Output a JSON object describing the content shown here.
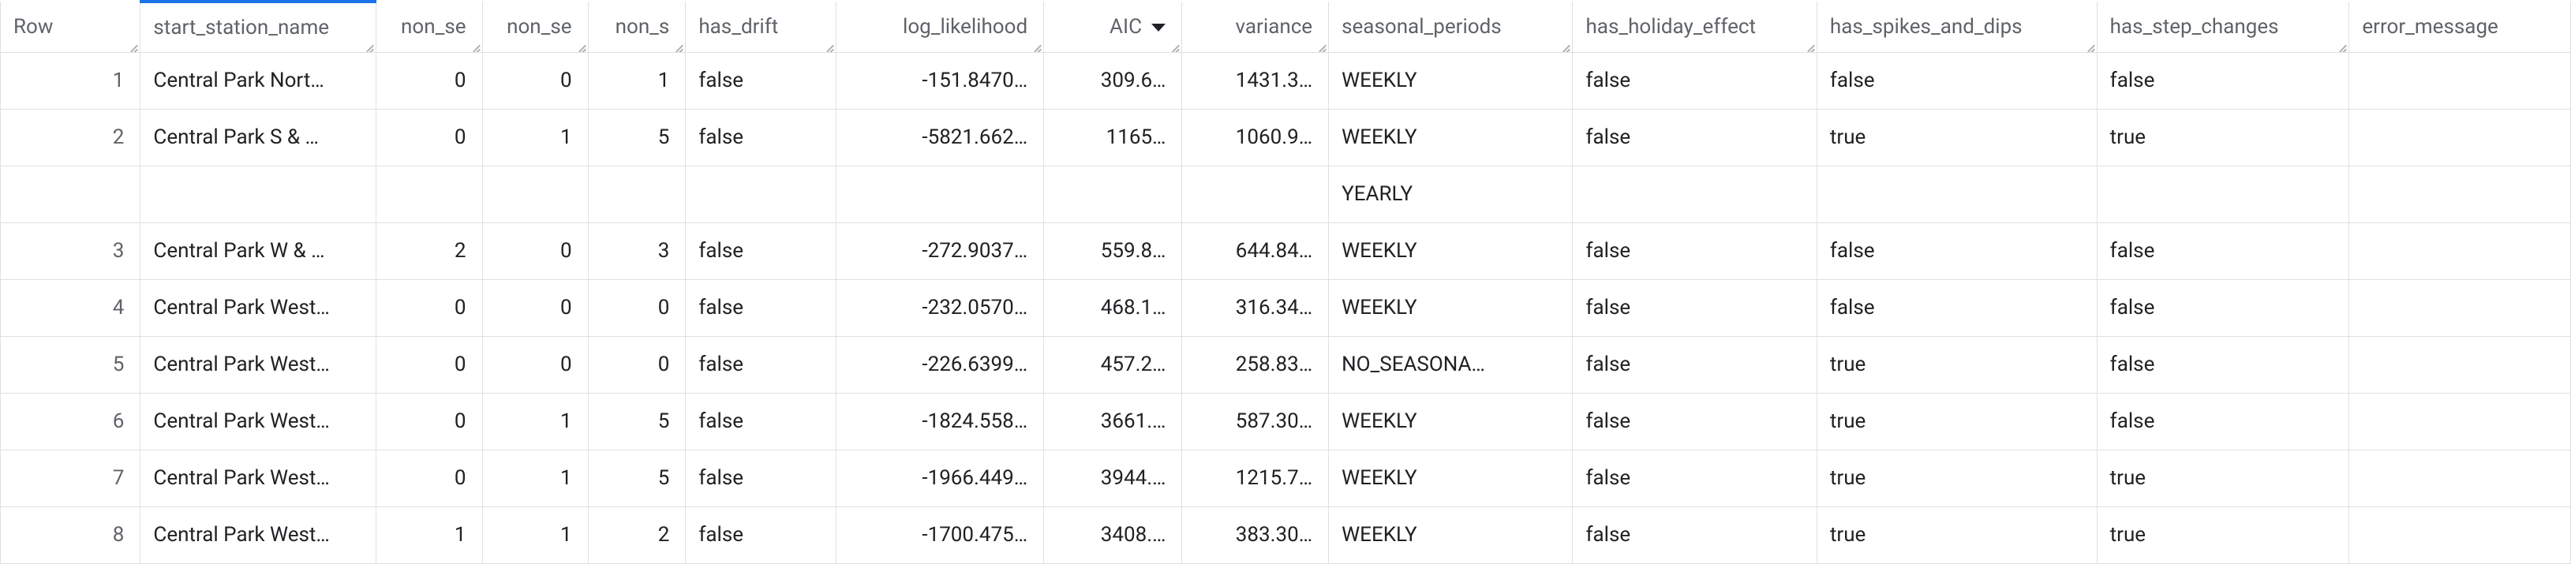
{
  "headers": {
    "row": "Row",
    "start_station_name": "start_station_name",
    "non_se1": "non_se",
    "non_se2": "non_se",
    "non_s": "non_s",
    "has_drift": "has_drift",
    "log_likelihood": "log_likelihood",
    "aic": "AIC",
    "variance": "variance",
    "seasonal_periods": "seasonal_periods",
    "has_holiday_effect": "has_holiday_effect",
    "has_spikes_and_dips": "has_spikes_and_dips",
    "has_step_changes": "has_step_changes",
    "error_message": "error_message"
  },
  "rows": [
    {
      "row": "1",
      "station": "Central Park Nort…",
      "non_se1": "0",
      "non_se2": "0",
      "non_s": "1",
      "drift": "false",
      "loglik": "-151.8470…",
      "aic": "309.6…",
      "variance": "1431.3…",
      "seasonal": "WEEKLY",
      "holiday": "false",
      "spikes": "false",
      "step": "false",
      "error": ""
    },
    {
      "row": "2",
      "station": "Central Park S & …",
      "non_se1": "0",
      "non_se2": "1",
      "non_s": "5",
      "drift": "false",
      "loglik": "-5821.662…",
      "aic": "1165…",
      "variance": "1060.9…",
      "seasonal": "WEEKLY",
      "holiday": "false",
      "spikes": "true",
      "step": "true",
      "error": "",
      "sub_seasonal": "YEARLY"
    },
    {
      "row": "3",
      "station": "Central Park W & …",
      "non_se1": "2",
      "non_se2": "0",
      "non_s": "3",
      "drift": "false",
      "loglik": "-272.9037…",
      "aic": "559.8…",
      "variance": "644.84…",
      "seasonal": "WEEKLY",
      "holiday": "false",
      "spikes": "false",
      "step": "false",
      "error": ""
    },
    {
      "row": "4",
      "station": "Central Park West…",
      "non_se1": "0",
      "non_se2": "0",
      "non_s": "0",
      "drift": "false",
      "loglik": "-232.0570…",
      "aic": "468.1…",
      "variance": "316.34…",
      "seasonal": "WEEKLY",
      "holiday": "false",
      "spikes": "false",
      "step": "false",
      "error": ""
    },
    {
      "row": "5",
      "station": "Central Park West…",
      "non_se1": "0",
      "non_se2": "0",
      "non_s": "0",
      "drift": "false",
      "loglik": "-226.6399…",
      "aic": "457.2…",
      "variance": "258.83…",
      "seasonal": "NO_SEASONA…",
      "holiday": "false",
      "spikes": "true",
      "step": "false",
      "error": ""
    },
    {
      "row": "6",
      "station": "Central Park West…",
      "non_se1": "0",
      "non_se2": "1",
      "non_s": "5",
      "drift": "false",
      "loglik": "-1824.558…",
      "aic": "3661.…",
      "variance": "587.30…",
      "seasonal": "WEEKLY",
      "holiday": "false",
      "spikes": "true",
      "step": "false",
      "error": ""
    },
    {
      "row": "7",
      "station": "Central Park West…",
      "non_se1": "0",
      "non_se2": "1",
      "non_s": "5",
      "drift": "false",
      "loglik": "-1966.449…",
      "aic": "3944.…",
      "variance": "1215.7…",
      "seasonal": "WEEKLY",
      "holiday": "false",
      "spikes": "true",
      "step": "true",
      "error": ""
    },
    {
      "row": "8",
      "station": "Central Park West…",
      "non_se1": "1",
      "non_se2": "1",
      "non_s": "2",
      "drift": "false",
      "loglik": "-1700.475…",
      "aic": "3408.…",
      "variance": "383.30…",
      "seasonal": "WEEKLY",
      "holiday": "false",
      "spikes": "true",
      "step": "true",
      "error": ""
    }
  ]
}
